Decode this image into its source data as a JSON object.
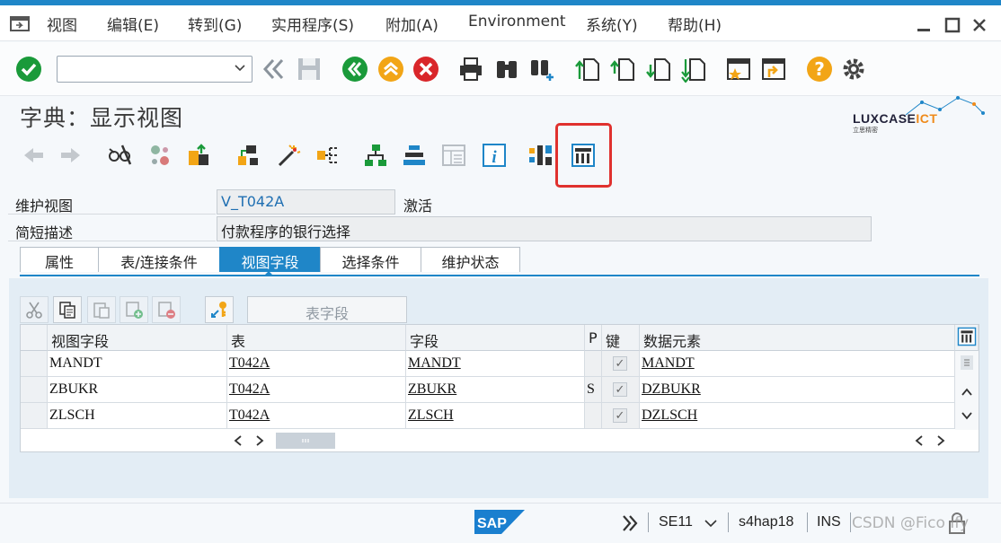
{
  "menu": {
    "items": [
      "视图",
      "编辑(E)",
      "转到(G)",
      "实用程序(S)",
      "附加(A)",
      "Environment",
      "系统(Y)",
      "帮助(H)"
    ]
  },
  "toolbar": {
    "command_value": "",
    "icons": [
      "check-icon",
      "command-dropdown",
      "double-chevron-left-icon",
      "save-icon",
      "back-icon",
      "exit-icon",
      "cancel-icon",
      "print-icon",
      "find-icon",
      "find-next-icon",
      "first-page-icon",
      "prev-page-icon",
      "next-page-icon",
      "last-page-icon",
      "new-session-icon",
      "shortcut-icon",
      "help-icon",
      "settings-icon"
    ]
  },
  "page": {
    "title": "字典：显示视图"
  },
  "logo": {
    "brand": "LUXCASE",
    "brand_suffix": "ICT",
    "sub": "立思精密"
  },
  "fields": {
    "maintenance_view_label": "维护视图",
    "maintenance_view_value": "V_T042A",
    "status": "激活",
    "short_desc_label": "简短描述",
    "short_desc_value": "付款程序的银行选择"
  },
  "tabs": [
    {
      "label": "属性",
      "active": false
    },
    {
      "label": "表/连接条件",
      "active": false
    },
    {
      "label": "视图字段",
      "active": true
    },
    {
      "label": "选择条件",
      "active": false
    },
    {
      "label": "维护状态",
      "active": false
    }
  ],
  "table_toolbar": {
    "table_fields_label": "表字段"
  },
  "grid": {
    "headers": [
      "视图字段",
      "表",
      "字段",
      "P",
      "键",
      "数据元素"
    ],
    "rows": [
      {
        "view_field": "MANDT",
        "table": "T042A",
        "field": "MANDT",
        "p": "",
        "key": true,
        "data_element": "MANDT"
      },
      {
        "view_field": "ZBUKR",
        "table": "T042A",
        "field": "ZBUKR",
        "p": "S",
        "key": true,
        "data_element": "DZBUKR"
      },
      {
        "view_field": "ZLSCH",
        "table": "T042A",
        "field": "ZLSCH",
        "p": "",
        "key": true,
        "data_element": "DZLSCH"
      }
    ]
  },
  "statusbar": {
    "transaction": "SE11",
    "system": "s4hap18",
    "mode": "INS",
    "watermark": "CSDN @Fico Ify"
  },
  "colors": {
    "accent": "#1f86c8",
    "highlight_box": "#e0312e",
    "ok_green": "#1a9a3a",
    "orange": "#f2a516"
  }
}
